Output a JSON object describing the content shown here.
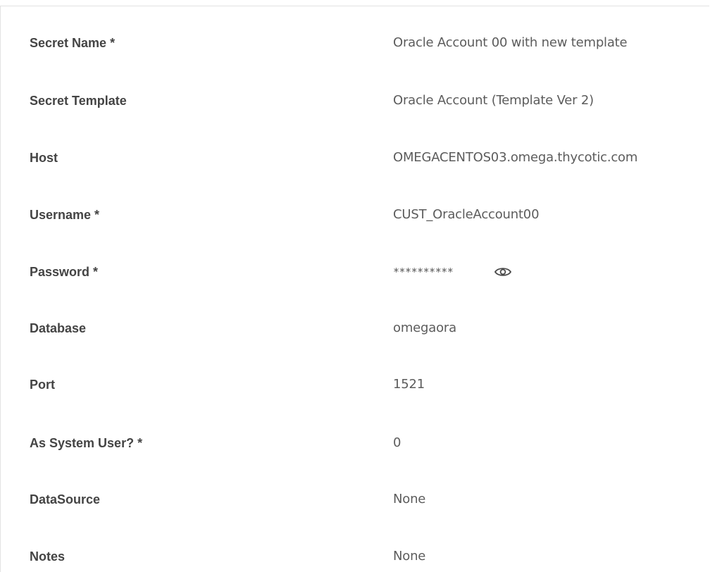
{
  "fields": [
    {
      "label": "Secret Name *",
      "value": "Oracle Account 00 with new template"
    },
    {
      "label": "Secret Template",
      "value": "Oracle Account (Template Ver 2)"
    },
    {
      "label": "Host",
      "value": "OMEGACENTOS03.omega.thycotic.com"
    },
    {
      "label": "Username *",
      "value": "CUST_OracleAccount00"
    },
    {
      "label": "Password *",
      "value": "**********"
    },
    {
      "label": "Database",
      "value": "omegaora"
    },
    {
      "label": "Port",
      "value": "1521"
    },
    {
      "label": "As System User? *",
      "value": "0"
    },
    {
      "label": "DataSource",
      "value": "None"
    },
    {
      "label": "Notes",
      "value": "None"
    }
  ],
  "icons": {
    "reveal_password": "eye-icon"
  },
  "colors": {
    "label": "#444444",
    "value": "#5c5c5c",
    "border": "#e2e2e2"
  }
}
